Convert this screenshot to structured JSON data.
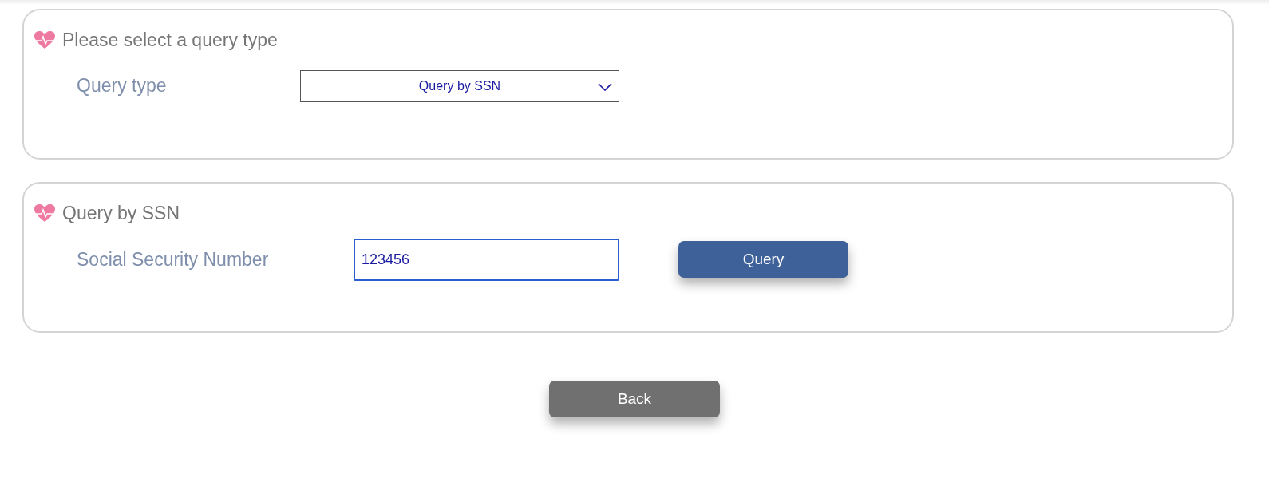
{
  "panels": [
    {
      "title": "Please select a query type",
      "field": {
        "kind": "select",
        "label": "Query type",
        "value": "Query by SSN"
      }
    },
    {
      "title": "Query by SSN",
      "field": {
        "kind": "input",
        "label": "Social Security Number",
        "value": "123456",
        "focused": true
      },
      "button": "Query"
    }
  ],
  "back_button": "Back"
}
